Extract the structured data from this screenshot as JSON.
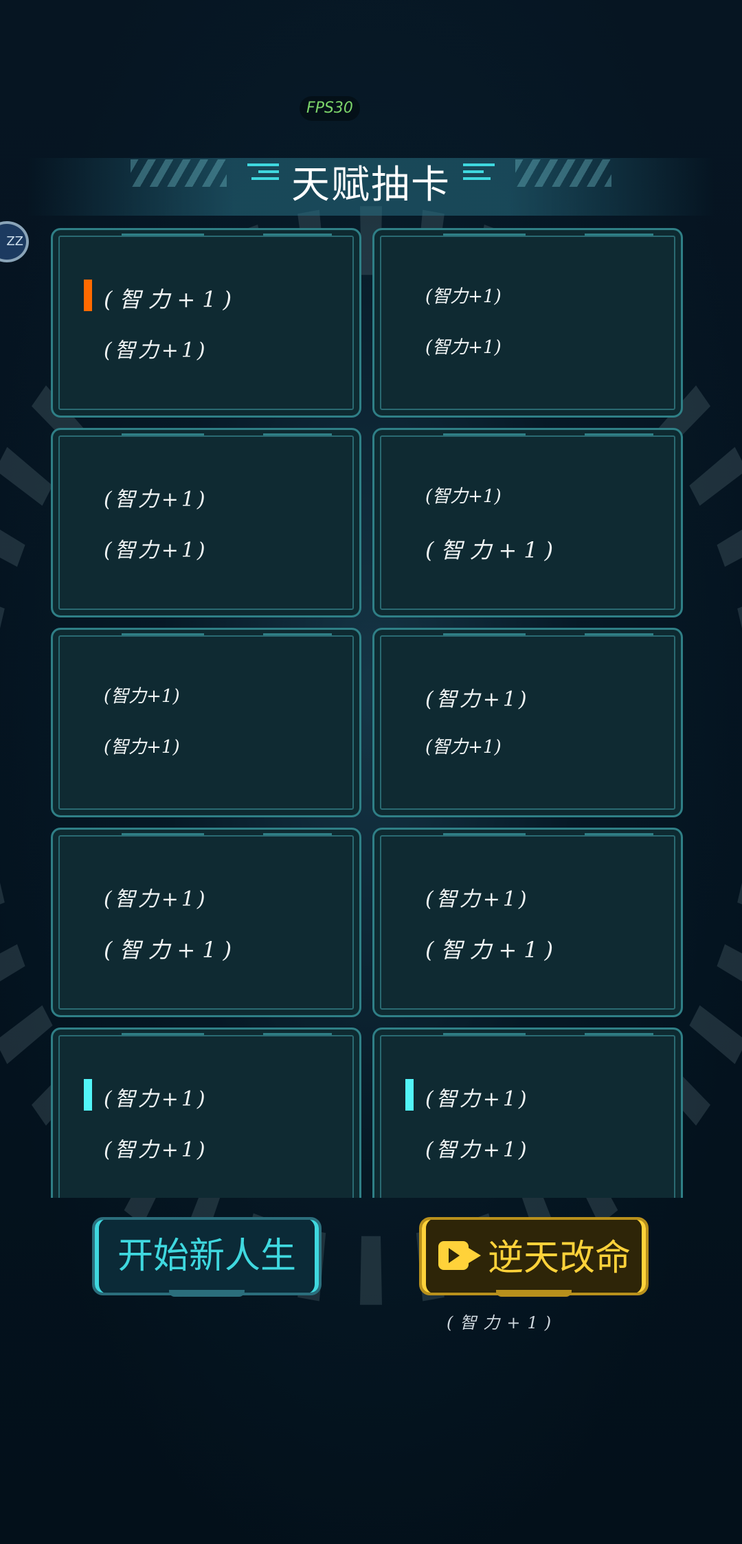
{
  "fps": "FPS30",
  "title": "天赋抽卡",
  "avatar_text": "ZZ",
  "colors": {
    "marker_orange": "#ff6a00",
    "marker_cyan": "#52f5f8",
    "button_cyan": "#3fd8df",
    "button_gold": "#ffd23a"
  },
  "cards": [
    {
      "line1": "(智力+1)",
      "line2": "(智力+1)",
      "marker": "orange",
      "size1": "l",
      "size2": "m"
    },
    {
      "line1": "(智力+1)",
      "line2": "(智力+1)",
      "marker": "none",
      "size1": "s",
      "size2": "s"
    },
    {
      "line1": "(智力+1)",
      "line2": "(智力+1)",
      "marker": "none",
      "size1": "m",
      "size2": "m"
    },
    {
      "line1": "(智力+1)",
      "line2": "(智力+1)",
      "marker": "none",
      "size1": "s",
      "size2": "l"
    },
    {
      "line1": "(智力+1)",
      "line2": "(智力+1)",
      "marker": "none",
      "size1": "s",
      "size2": "s"
    },
    {
      "line1": "(智力+1)",
      "line2": "(智力+1)",
      "marker": "none",
      "size1": "m",
      "size2": "s"
    },
    {
      "line1": "(智力+1)",
      "line2": "(智力+1)",
      "marker": "none",
      "size1": "m",
      "size2": "l"
    },
    {
      "line1": "(智力+1)",
      "line2": "(智力+1)",
      "marker": "none",
      "size1": "m",
      "size2": "l"
    },
    {
      "line1": "(智力+1)",
      "line2": "(智力+1)",
      "marker": "cyan",
      "size1": "m",
      "size2": "m"
    },
    {
      "line1": "(智力+1)",
      "line2": "(智力+1)",
      "marker": "cyan",
      "size1": "m",
      "size2": "m"
    }
  ],
  "buttons": {
    "new_life": "开始新人生",
    "change_fate": "逆天改命",
    "change_fate_note": "(智力+1)"
  }
}
